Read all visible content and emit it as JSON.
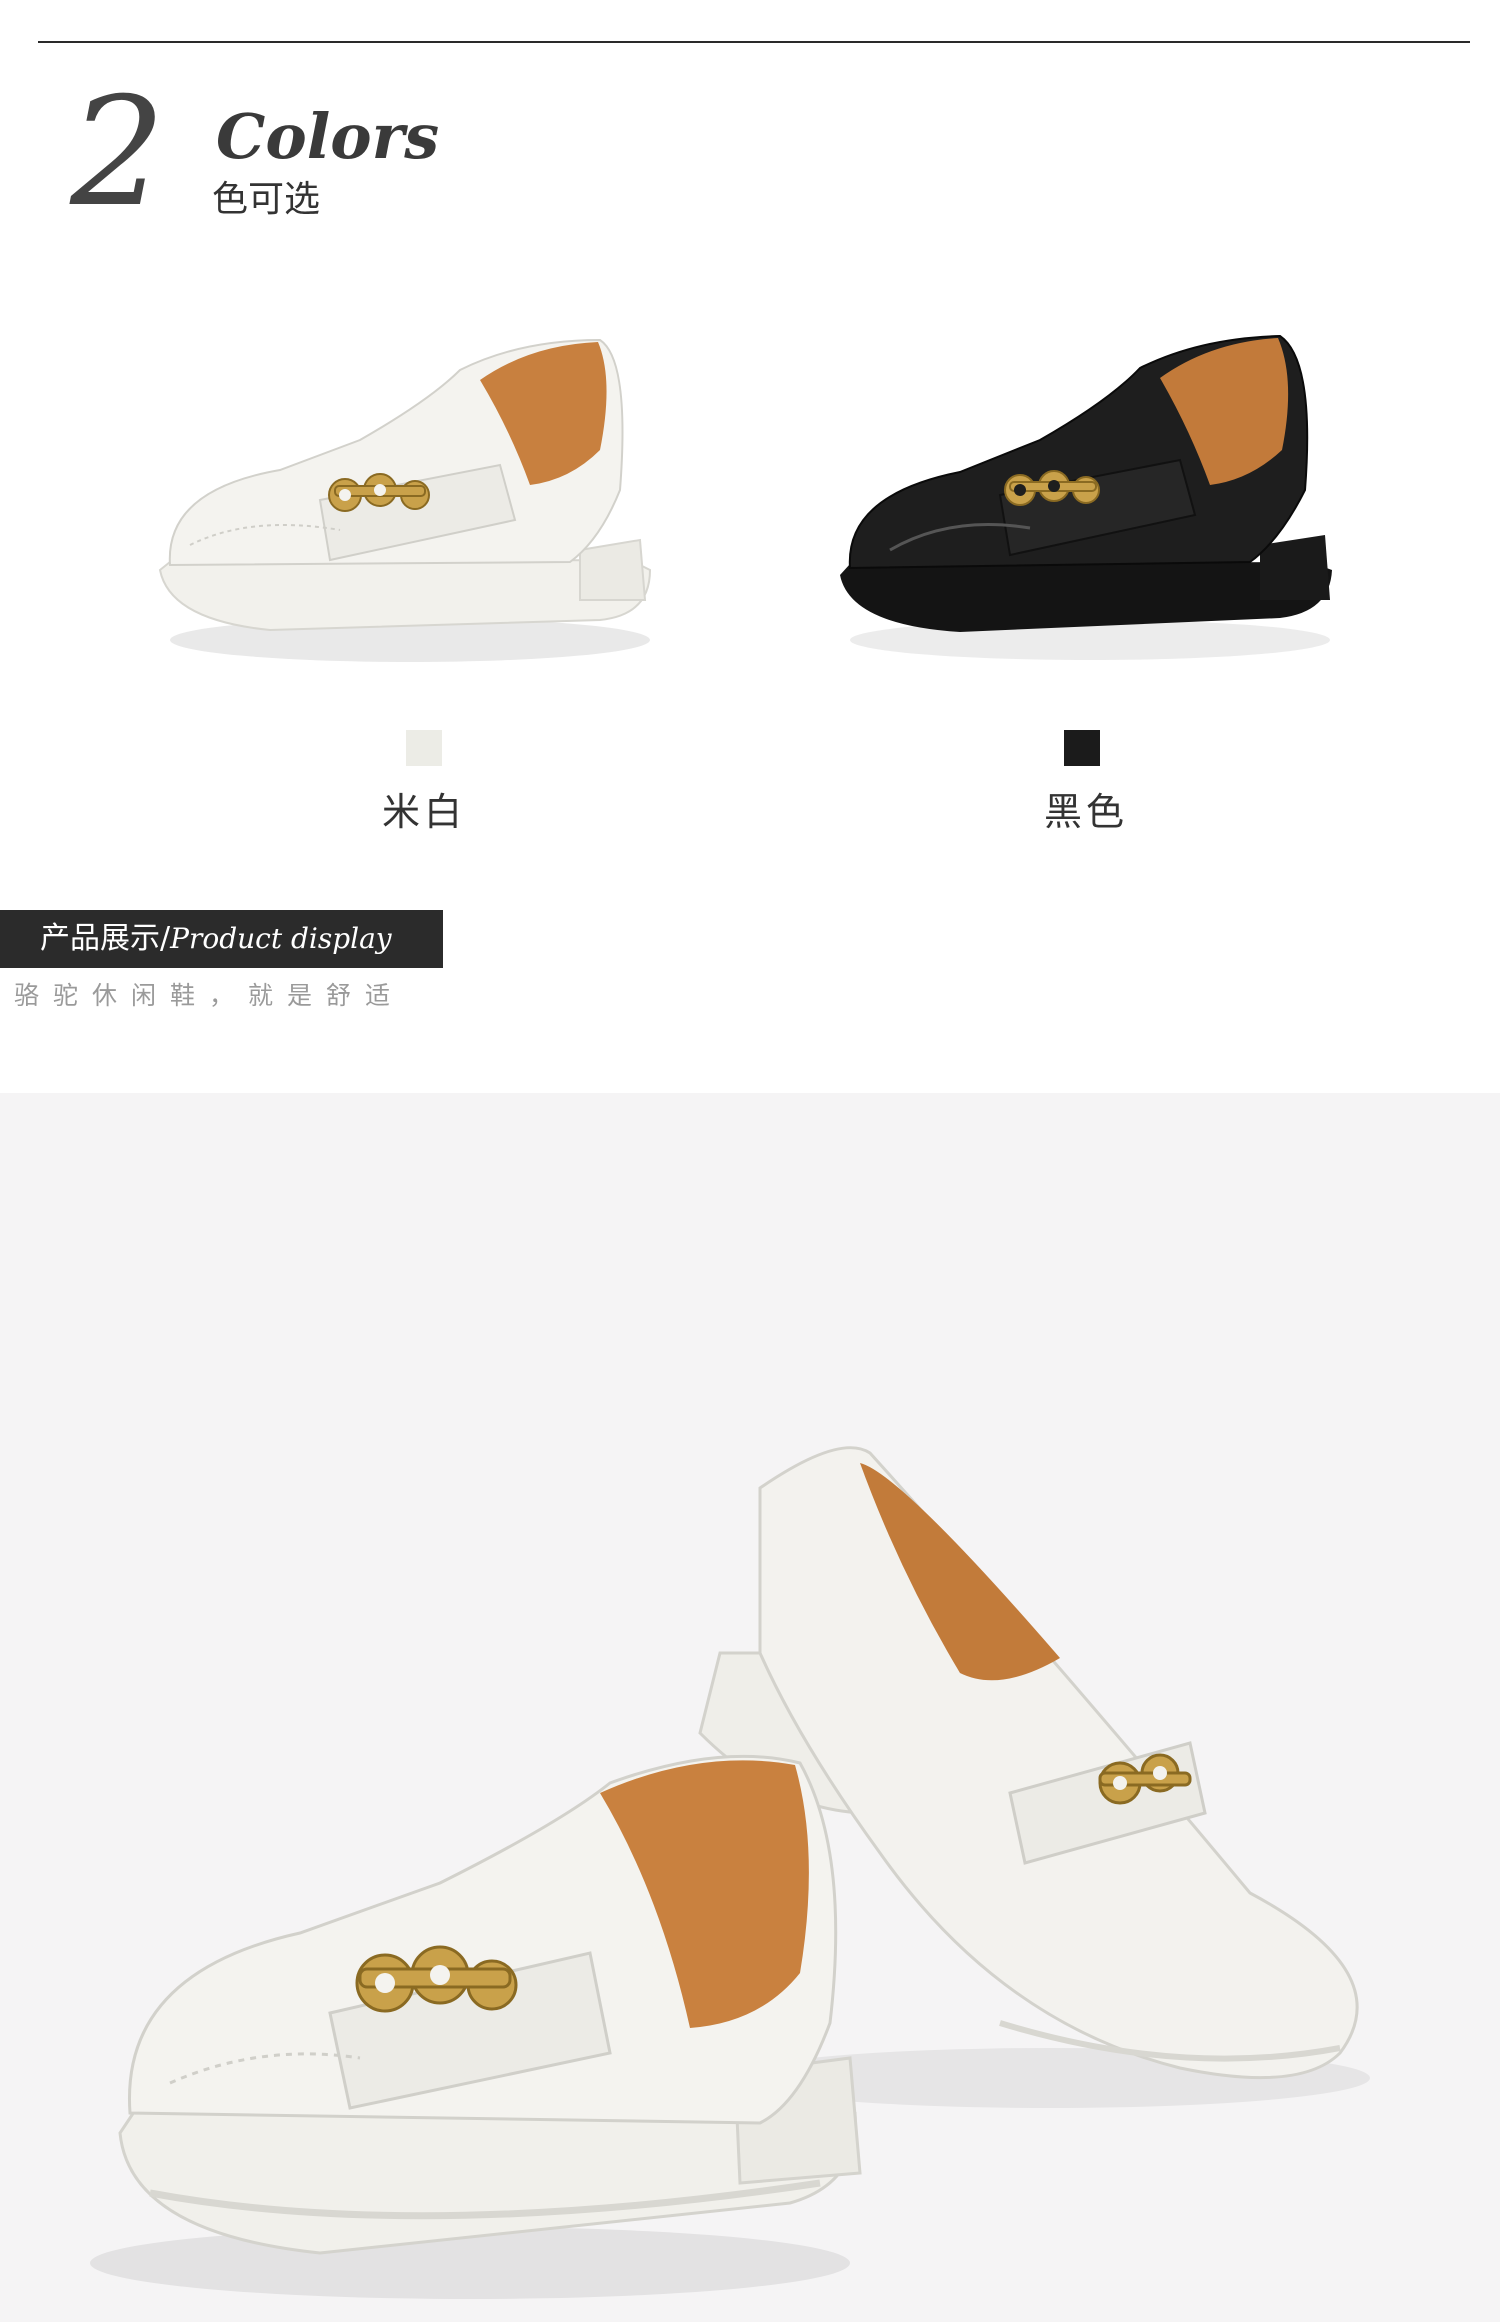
{
  "colors_section": {
    "count_numeral": "2",
    "heading_word": "Colors",
    "subheading": "色可选",
    "options": [
      {
        "name": "米白",
        "swatch_color": "#ecece6"
      },
      {
        "name": "黑色",
        "swatch_color": "#1b1b1b"
      }
    ]
  },
  "display_section": {
    "banner_cn": "产品展示/",
    "banner_en": "Product display",
    "subtitle": "骆驼休闲鞋，就是舒适"
  }
}
